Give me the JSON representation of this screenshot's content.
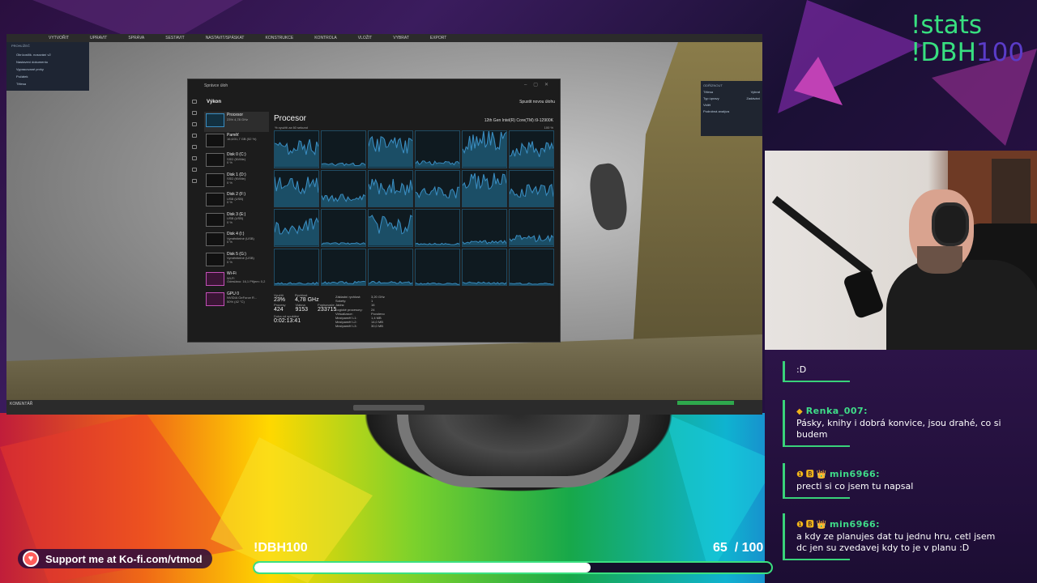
{
  "overlay": {
    "command_stats": "!stats",
    "command_dbh_prefix": "!DBH",
    "command_dbh_num": "100"
  },
  "app": {
    "menu": [
      "VYTVOŘIT",
      "UPRAVIT",
      "SPRÁVA",
      "SESTAVIT",
      "NASTAVIT/SPÁSKAT",
      "KONSTRUKCE",
      "KONTROLA",
      "VLOŽIT",
      "VYBRAT",
      "EXPORT"
    ],
    "left_panel_title": "PROHLÍŽEČ",
    "left_panel_items": [
      "Obr.kostlík. nosování v2",
      "Nastavení dokumentu",
      "Vypracované prvky",
      "Počátek",
      "Tělesa"
    ],
    "right_panel_title": "ODŘÍZNOUT",
    "right_panel_rows": [
      "Tělesa",
      "Typ úpravy",
      "Vidět",
      "Podrobná analýza"
    ],
    "right_panel_values": [
      "Vybrat",
      "Zadávání",
      ""
    ],
    "bottom_label": "KOMENTÁŘ"
  },
  "taskmgr": {
    "window_title": "Správce úloh",
    "section": "Výkon",
    "run_task": "Spustit novou úlohu",
    "heading": "Procesor",
    "cpu_name": "12th Gen Intel(R) Core(TM) i9-12900K",
    "util_label": "% využití za 60 sekund",
    "util_max": "100 %",
    "items": [
      {
        "title": "Procesor",
        "sub": "23% 4,78 GHz",
        "thumb": "blue"
      },
      {
        "title": "Paměť",
        "sub": "16,6/31,7 GB (52 %)",
        "thumb": "gray"
      },
      {
        "title": "Disk 0 (C:)",
        "sub": "SSD (NVMe)\n0 %",
        "thumb": "gray"
      },
      {
        "title": "Disk 1 (D:)",
        "sub": "SSD (NVMe)\n0 %",
        "thumb": "gray"
      },
      {
        "title": "Disk 2 (F:)",
        "sub": "USB (USB)\n0 %",
        "thumb": "gray"
      },
      {
        "title": "Disk 3 (E:)",
        "sub": "USB (USB)\n0 %",
        "thumb": "gray"
      },
      {
        "title": "Disk 4 (I:)",
        "sub": "Vyměnitelné (USB)\n0 %",
        "thumb": "gray"
      },
      {
        "title": "Disk 5 (G:)",
        "sub": "Vyměnitelné (USB)\n0 %",
        "thumb": "gray"
      },
      {
        "title": "Wi-Fi",
        "sub": "Wi-Fi\nOdesláno: 16,1 Přijem: 0,2",
        "thumb": "pink"
      },
      {
        "title": "GPU 0",
        "sub": "NVIDIA GeForce R...\n50% (42 °C)",
        "thumb": "pink"
      }
    ],
    "stats": {
      "util_k": "Využití",
      "util_v": "23%",
      "speed_k": "Rychlost",
      "speed_v": "4,78 GHz",
      "proc_k": "Procesy",
      "proc_v": "424",
      "threads_k": "Vlákna",
      "threads_v": "9153",
      "handles_k": "Popisovače",
      "handles_v": "233715",
      "uptime_k": "Doba od spuštění",
      "uptime_v": "0:02:13:41"
    },
    "specs": [
      [
        "Základní rychlost:",
        "3,20 GHz"
      ],
      [
        "Sokety:",
        "1"
      ],
      [
        "Jádra:",
        "16"
      ],
      [
        "Logické procesory:",
        "24"
      ],
      [
        "Virtualizace:",
        "Povoleno"
      ],
      [
        "Mezipaměť L1:",
        "1,4 MB"
      ],
      [
        "Mezipaměť L2:",
        "14,0 MB"
      ],
      [
        "Mezipaměť L3:",
        "30,0 MB"
      ]
    ],
    "core_loads": [
      0.55,
      0.08,
      0.6,
      0.12,
      0.7,
      0.5,
      0.6,
      0.25,
      0.55,
      0.4,
      0.65,
      0.45,
      0.55,
      0.06,
      0.6,
      0.05,
      0.1,
      0.2,
      0.06,
      0.08,
      0.08,
      0.05,
      0.07,
      0.05
    ]
  },
  "chat": [
    {
      "name": "",
      "badges": "",
      "text": ":D"
    },
    {
      "name": "Renka_007:",
      "badges": "◆",
      "text": "Pásky, knihy i dobrá konvice, jsou drahé, co si budem"
    },
    {
      "name": "min6966:",
      "badges": "❶ 🅱 👑",
      "text": "precti si co jsem tu napsal"
    },
    {
      "name": "min6966:",
      "badges": "❶ 🅱 👑",
      "text": "a kdy ze planujes dat tu jednu hru, cetl jsem dc jen su zvedavej kdy to je v planu :D"
    }
  ],
  "kofi": {
    "text": "Support me at Ko-fi.com/vtmod",
    "icon": "kofi-cup-icon"
  },
  "goal": {
    "label": "!DBH100",
    "current": "65",
    "separator": "/",
    "target": "100",
    "progress": 0.65
  },
  "colors": {
    "accent_green": "#3fdc88",
    "kofi_red": "#ff5e5b",
    "cpu_line": "#3a8dc1"
  }
}
